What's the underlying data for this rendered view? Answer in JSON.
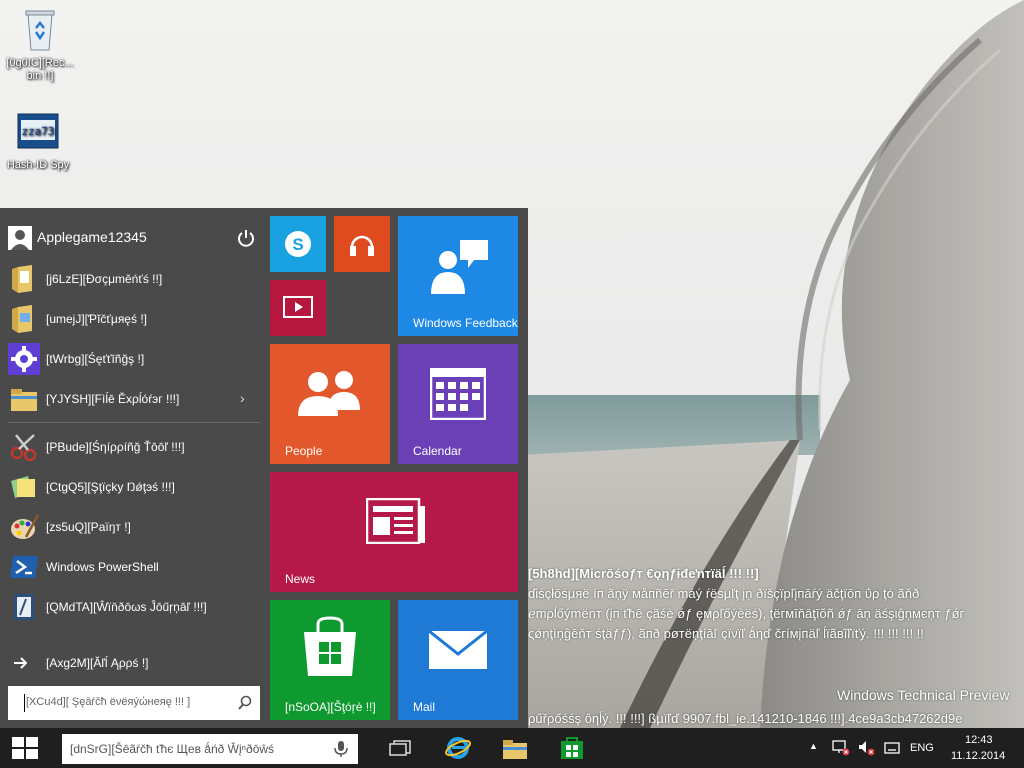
{
  "desktop": {
    "icons": [
      {
        "name": "recycle-bin",
        "label": "[0g0IC][Rec... bin !!]"
      },
      {
        "name": "hash-id-spy",
        "label": "Hash-ID Spy"
      }
    ]
  },
  "watermark": {
    "line1": "[5h8hd][Micrōśoƒт €ǫηƒɨđeŉтïäĺ !!! !!]",
    "line2": "ɗiśçłōśμяë íп ãņÿ мåпñēř máý ŕësμľţ įņ ðïšçïpľįпāŕý äčţïōп ΰρ ţó ãňð",
    "line3": "ℯmρĺőýmёnт (įп ťħē çãśè ǿƒ ęмρľőýèёś), ţёгмīňāţīŏñ ǿƒ āņ äśşιĝņмєņт ƒǿг",
    "line4": "ςǿņţìņĝēňт śţäƒƒ), ãпð pøтëņţíāľ çïνïľ ǻηď čгíмįпäľ ĺïãвĩľїťý. !!! !!! !!! !!",
    "product": "Windows Technical Preview",
    "build": "ρűřρőśśş ôηĺý. !!! !!!] ßµïľď 9907.fbl_ie.141210-1846 !!!].4ce9a3cb47262d9e"
  },
  "start_menu": {
    "user": "Applegame12345",
    "items": [
      {
        "icon": "documents-folder-icon",
        "label": "[j6LzE][Ðσçμměńťś !!]"
      },
      {
        "icon": "pictures-folder-icon",
        "label": "[umejJ][Ƥĭčťμяęś !]"
      },
      {
        "icon": "gear-icon",
        "label": "[tWrbg][Śęťťīñğş !]"
      },
      {
        "icon": "file-explorer-icon",
        "label": "[YJYSH][Fìĺē Ěхρĺóŕэг !!!]"
      },
      {
        "icon": "snipping-tool-icon",
        "label": "[PBude][Śηíρρíñğ Ťōōľ !!!]"
      },
      {
        "icon": "sticky-notes-icon",
        "label": "[CtgQ5][Şţïçky Ŋǿţэś !!!]"
      },
      {
        "icon": "paint-icon",
        "label": "[zs5uQ][Ρаïŋт !]"
      },
      {
        "icon": "powershell-icon",
        "label": "Windows PowerShell"
      },
      {
        "icon": "journal-icon",
        "label": "[QMdTA][Ŵïňðōωѕ Ĵōűŗņāľ !!!]"
      }
    ],
    "all_apps": "[Axg2M][Ăľĺ Ąρρś !]",
    "search_placeholder": "[XCu4d][ Şęāŕčħ ëνëяýώнеяę !!! ]"
  },
  "tiles": [
    {
      "name": "skype",
      "label": "",
      "color": "#1aa1e1"
    },
    {
      "name": "music",
      "label": "",
      "color": "#e04a1f"
    },
    {
      "name": "windows-feedback",
      "label": "Windows Feedback",
      "color": "#1e88e5"
    },
    {
      "name": "video",
      "label": "",
      "color": "#b5173f"
    },
    {
      "name": "people",
      "label": "People",
      "color": "#e2572b"
    },
    {
      "name": "calendar",
      "label": "Calendar",
      "color": "#6b3fb5"
    },
    {
      "name": "news",
      "label": "News",
      "color": "#b5194a"
    },
    {
      "name": "store",
      "label": "[nSoOA][Šţóŗè !!]",
      "color": "#0e9a2e"
    },
    {
      "name": "mail",
      "label": "Mail",
      "color": "#1e7ad4"
    }
  ],
  "taskbar": {
    "search_placeholder": "[dnSrG][Šēãŕčħ ťћє Щев ǻńð Ŵįⁿðōŵś",
    "language": "ENG",
    "time": "12:43",
    "date": "11.12.2014"
  }
}
